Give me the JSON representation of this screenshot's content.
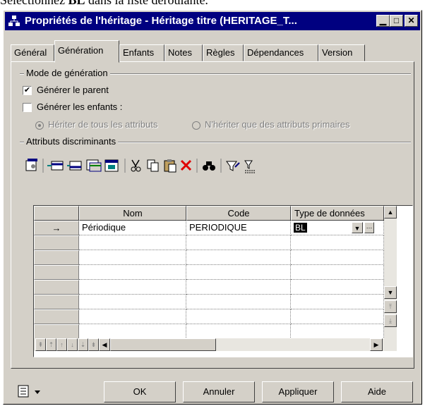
{
  "caption": {
    "prefix": "Sélectionnez ",
    "bold": "BL",
    "suffix": " dans la liste déroulante."
  },
  "window": {
    "title": "Propriétés de l'héritage - Héritage titre (HERITAGE_T..."
  },
  "tabs": [
    "Général",
    "Génération",
    "Enfants",
    "Notes",
    "Règles",
    "Dépendances",
    "Version"
  ],
  "active_tab": "Génération",
  "generation": {
    "group_label": "Mode de génération",
    "generate_parent": {
      "label": "Générer le parent",
      "checked": true
    },
    "generate_children": {
      "label": "Générer les enfants :",
      "checked": false
    },
    "inherit_all": {
      "label": "Hériter de tous les attributs",
      "selected": true
    },
    "inherit_primary": {
      "label": "N'hériter que des attributs primaires",
      "selected": false
    }
  },
  "discriminants": {
    "group_label": "Attributs discriminants"
  },
  "toolbar_icons": [
    "properties-icon",
    "add-row-icon",
    "insert-row-icon",
    "add-attributes-icon",
    "create-attribute-icon",
    "cut-icon",
    "copy-icon",
    "paste-icon",
    "delete-icon",
    "find-icon",
    "filter-icon",
    "customize-columns-icon"
  ],
  "grid": {
    "columns": [
      "Nom",
      "Code",
      "Type de données"
    ],
    "rows": [
      {
        "marker": "→",
        "nom": "Périodique",
        "code": "PERIODIQUE",
        "type": "BL"
      }
    ],
    "empty_rows": 7
  },
  "buttons": {
    "ok": "OK",
    "cancel": "Annuler",
    "apply": "Appliquer",
    "help": "Aide"
  },
  "colors": {
    "titlebar": "#000080",
    "face": "#d4d0c8"
  }
}
